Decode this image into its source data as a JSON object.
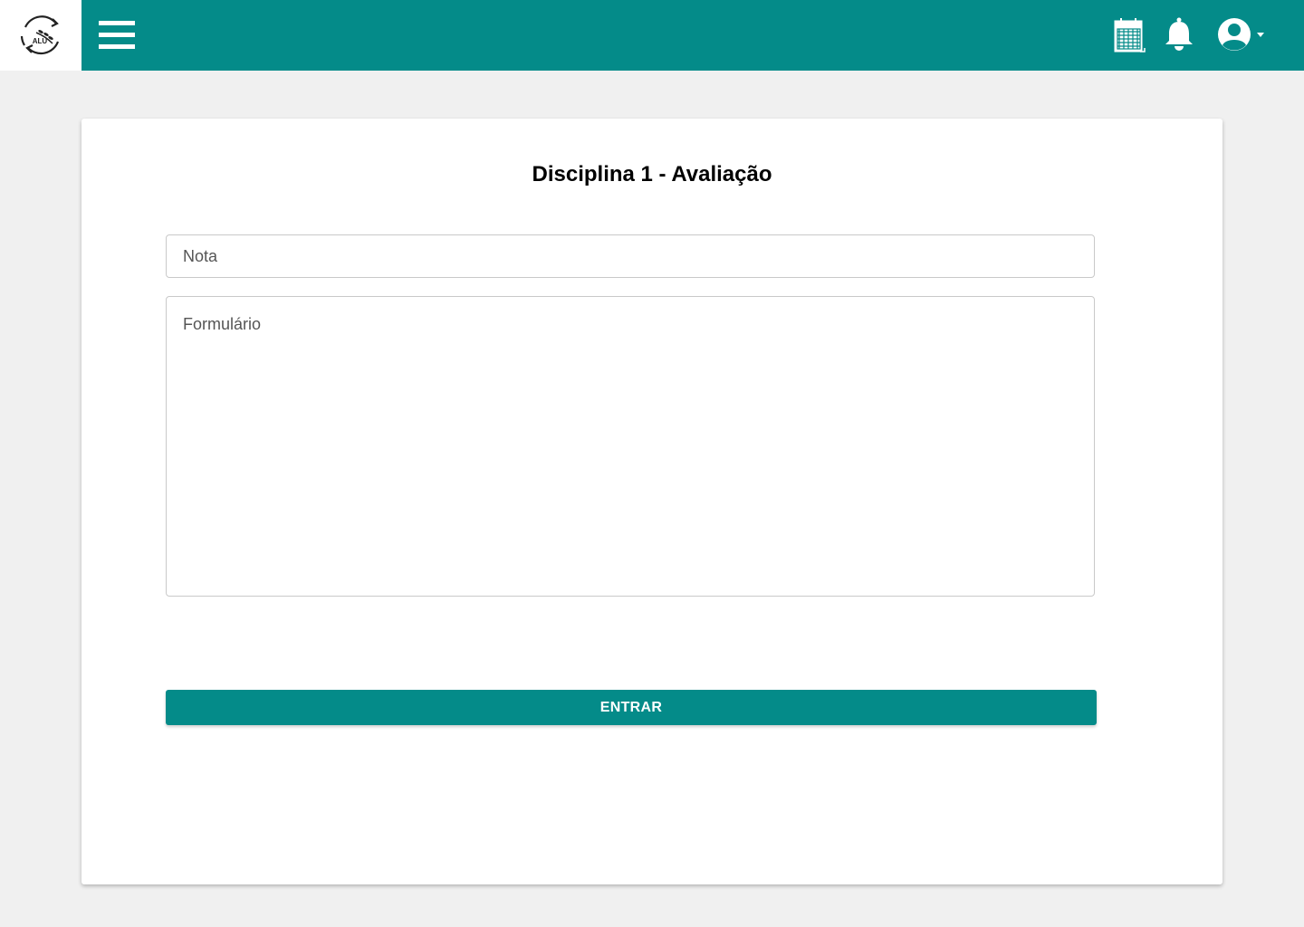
{
  "header": {
    "logo_text": "ALU",
    "menu_icon": "hamburger-menu-icon",
    "calendar_icon": "calendar-icon",
    "notification_icon": "bell-icon",
    "user_icon": "user-account-icon",
    "brand_color": "#048b89"
  },
  "form": {
    "title": "Disciplina 1 - Avaliação",
    "nota_placeholder": "Nota",
    "formulario_placeholder": "Formulário",
    "submit_label": "ENTRAR"
  }
}
